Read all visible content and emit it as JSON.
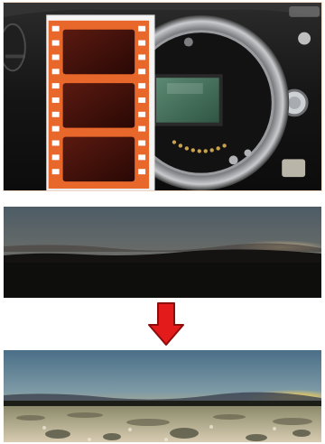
{
  "images": {
    "camera": {
      "subject": "camera-body-with-film-strip",
      "visible_text": []
    },
    "before": {
      "subject": "underexposed-landscape",
      "visible_text": []
    },
    "after": {
      "subject": "corrected-landscape",
      "visible_text": []
    }
  },
  "arrow": {
    "direction": "down",
    "color": "#e31b1b"
  },
  "colors": {
    "film_orange": "#e8672a",
    "accent_red": "#e31b1b",
    "sensor_green": "#3f6b56"
  }
}
